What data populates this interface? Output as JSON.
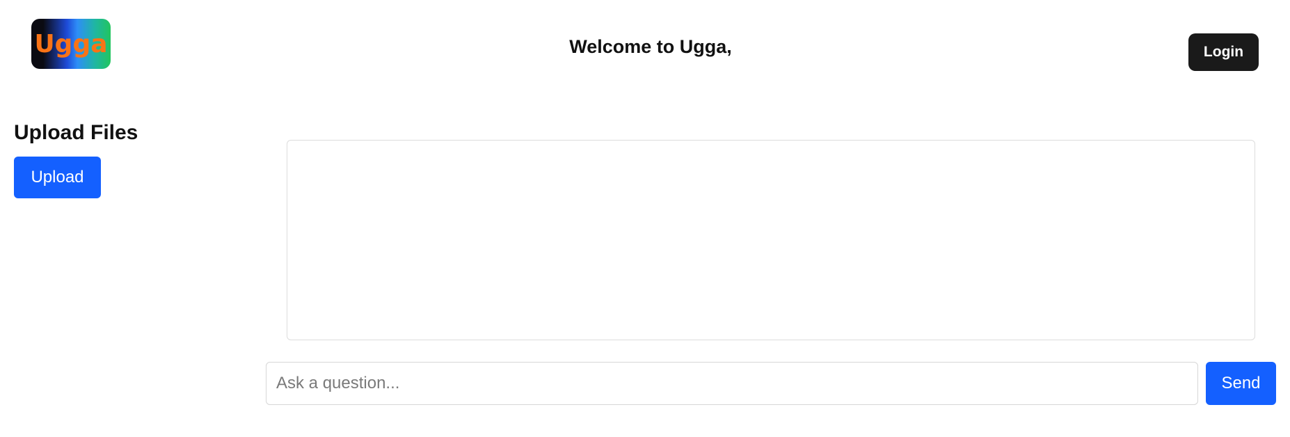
{
  "header": {
    "logo_text": "Ugga",
    "welcome_text": "Welcome to Ugga,",
    "login_label": "Login"
  },
  "upload": {
    "title": "Upload Files",
    "button_label": "Upload"
  },
  "chat": {
    "input_placeholder": "Ask a question...",
    "input_value": "",
    "send_label": "Send"
  },
  "colors": {
    "primary": "#1460ff",
    "dark_button": "#1a1a1a",
    "logo_text": "#f97316"
  }
}
